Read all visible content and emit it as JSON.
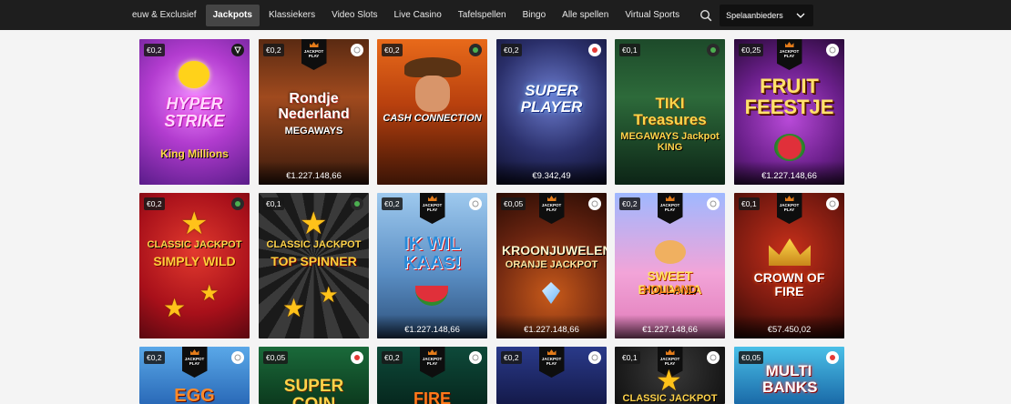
{
  "nav": {
    "items": [
      {
        "label": "euw & Exclusief"
      },
      {
        "label": "Jackpots"
      },
      {
        "label": "Klassiekers"
      },
      {
        "label": "Video Slots"
      },
      {
        "label": "Live Casino"
      },
      {
        "label": "Tafelspellen"
      },
      {
        "label": "Bingo"
      },
      {
        "label": "Alle spellen"
      },
      {
        "label": "Virtual Sports"
      }
    ],
    "active_item": "Jackpots",
    "search_icon": "search-icon",
    "dropdown_label": "Spelaanbieders",
    "dropdown_icon": "chevron-down-icon"
  },
  "jackpot_badge_text": "JACKPOT PLAY",
  "games": [
    {
      "bet": "€0,2",
      "title": "HYPER STRIKE",
      "subtitle": "King Millions",
      "amount": ""
    },
    {
      "bet": "€0,2",
      "title": "Rondje Nederland",
      "subtitle": "MEGAWAYS",
      "amount": "€1.227.148,66"
    },
    {
      "bet": "€0,2",
      "title": "CASH CONNECTION",
      "subtitle": "",
      "amount": ""
    },
    {
      "bet": "€0,2",
      "title": "SUPER PLAYER",
      "subtitle": "",
      "amount": "€9.342,49"
    },
    {
      "bet": "€0,1",
      "title": "TIKI Treasures",
      "subtitle": "MEGAWAYS Jackpot KING",
      "amount": ""
    },
    {
      "bet": "€0,25",
      "title": "FRUIT FEESTJE",
      "subtitle": "",
      "amount": "€1.227.148,66"
    },
    {
      "bet": "€0,2",
      "title": "CLASSIC JACKPOT",
      "subtitle": "SIMPLY WILD",
      "amount": ""
    },
    {
      "bet": "€0,1",
      "title": "CLASSIC JACKPOT",
      "subtitle": "TOP SPINNER",
      "amount": ""
    },
    {
      "bet": "€0,2",
      "title": "IK WIL KAAS!",
      "subtitle": "",
      "amount": "€1.227.148,66"
    },
    {
      "bet": "€0,05",
      "title": "KROONJUWELEN",
      "subtitle": "ORANJE JACKPOT",
      "amount": "€1.227.148,66"
    },
    {
      "bet": "€0,2",
      "title": "SWEET BONANZA",
      "subtitle": "HOLLAND",
      "amount": "€1.227.148,66"
    },
    {
      "bet": "€0,1",
      "title": "CROWN OF FIRE",
      "subtitle": "",
      "amount": "€57.450,02"
    },
    {
      "bet": "€0,2",
      "title": "EGG",
      "subtitle": "",
      "amount": ""
    },
    {
      "bet": "€0,05",
      "title": "SUPER COIN",
      "subtitle": "",
      "amount": ""
    },
    {
      "bet": "€0,2",
      "title": "FIRE",
      "subtitle": "",
      "amount": ""
    },
    {
      "bet": "€0,2",
      "title": "",
      "subtitle": "",
      "amount": ""
    },
    {
      "bet": "€0,1",
      "title": "CLASSIC JACKPOT",
      "subtitle": "",
      "amount": ""
    },
    {
      "bet": "€0,05",
      "title": "MULTI BANKS",
      "subtitle": "",
      "amount": ""
    }
  ]
}
